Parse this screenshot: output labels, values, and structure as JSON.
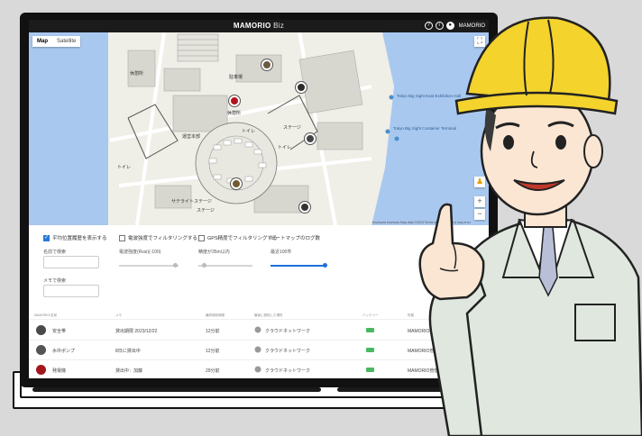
{
  "app": {
    "title": "MAMORIO",
    "title_suffix": " Biz",
    "user": "MAMORIO",
    "icons": [
      "help-icon",
      "info-icon",
      "user-icon"
    ]
  },
  "map": {
    "tabs": [
      {
        "label": "Map",
        "active": true
      },
      {
        "label": "Satellite",
        "active": false
      }
    ],
    "labels": {
      "bldg_a": "休憩所",
      "parking": "駐車場",
      "toilet1": "トイレ",
      "toilet2": "トイレ",
      "toilet3": "トイレ",
      "stage": "ステージ",
      "admin": "運営本部",
      "hq": "休憩所",
      "sub_stage": "サテライトステージ",
      "stage2": "ステージ"
    },
    "poi": "Tokyo Big Sight East Exhibition Hall",
    "poi2": "Tokyo Big Sight Container Terminal",
    "footer": "Keyboard shortcuts  Map data ©2023  Terms of Use  Report a map error"
  },
  "filters": {
    "checkboxes": [
      {
        "label": "平均位置履歴を表示する",
        "checked": true
      },
      {
        "label": "電波強度でフィルタリングする",
        "checked": false
      },
      {
        "label": "GPS精度でフィルタリングする",
        "checked": false
      },
      {
        "label": "ヒートマップのログ数",
        "checked": false
      }
    ],
    "name_label": "名前で検索",
    "memo_label": "メモで検索",
    "signal_label": "電波強度(Rssi)(-100)",
    "gps_label": "精度が35m以内",
    "heatmap_label": "最近100件",
    "signal_level": 0.9,
    "gps_level": 0.1,
    "heatmap_level": 0.95
  },
  "table": {
    "headers": [
      "MAMORIO/名前",
      "メモ",
      "最終検知時間",
      "最後に検知した場所",
      "バッテリー",
      "所属"
    ],
    "rows": [
      {
        "name": "安全帯",
        "memo": "貸出期限 2023/12/22",
        "time": "12分前",
        "place": "クラウドネットワーク",
        "org": "MAMORIO管理者"
      },
      {
        "name": "水中ポンプ",
        "memo": "8日に貸出中",
        "time": "12分前",
        "place": "クラウドネットワーク",
        "org": "MAMORIO管理者"
      },
      {
        "name": "発電機",
        "memo": "貸出中：加藤",
        "time": "29分前",
        "place": "クラウドネットワーク",
        "org": "MAMORIO管理者"
      }
    ]
  },
  "colors": {
    "accent": "#1e6fd9",
    "appbar": "#1b1b1b",
    "water": "#a9c8f0",
    "battery": "#49b960",
    "helmet": "#f3d32c"
  }
}
